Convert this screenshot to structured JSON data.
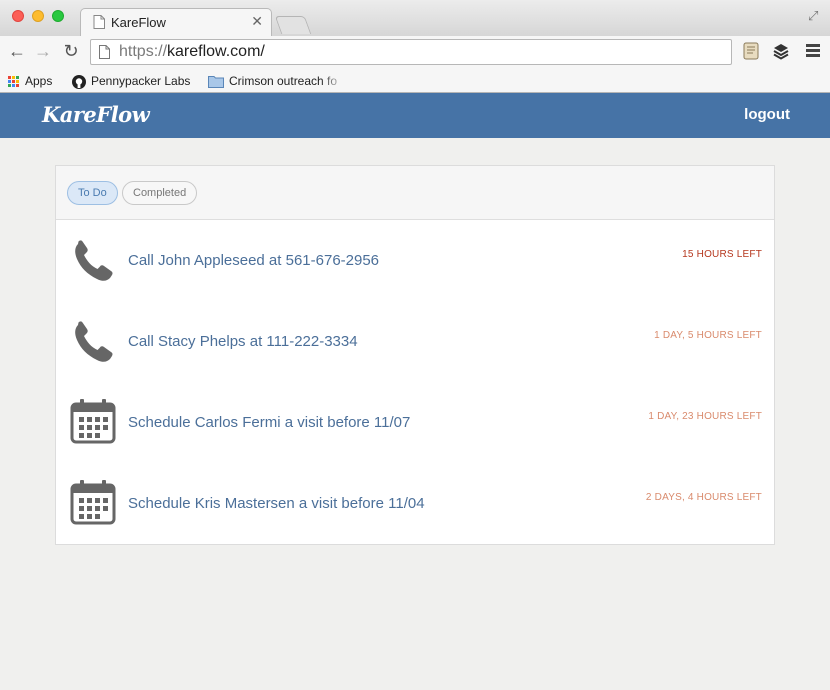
{
  "browser": {
    "tab_title": "KareFlow",
    "url_scheme": "https://",
    "url_rest": "kareflow.com/",
    "bookmarks": [
      {
        "label": "Apps",
        "icon": "apps-grid-icon"
      },
      {
        "label": "Pennypacker Labs",
        "icon": "github-icon"
      },
      {
        "label": "Crimson outreach fo",
        "icon": "folder-icon"
      }
    ]
  },
  "app": {
    "logo": "KareFlow",
    "logout_label": "logout",
    "brand_color": "#4673a6"
  },
  "filters": [
    {
      "label": "To Do",
      "active": true
    },
    {
      "label": "Completed",
      "active": false
    }
  ],
  "tasks": [
    {
      "icon": "phone-icon",
      "text": "Call John Appleseed at 561-676-2956",
      "due": "15 HOURS LEFT",
      "due_color": "#b5371e"
    },
    {
      "icon": "phone-icon",
      "text": "Call Stacy Phelps at 111-222-3334",
      "due": "1 DAY, 5 HOURS LEFT",
      "due_color": "#d98a6c"
    },
    {
      "icon": "calendar-icon",
      "text": "Schedule Carlos Fermi a visit before 11/07",
      "due": "1 DAY, 23 HOURS LEFT",
      "due_color": "#d98a6c"
    },
    {
      "icon": "calendar-icon",
      "text": "Schedule Kris Mastersen a visit before 11/04",
      "due": "2 DAYS, 4 HOURS LEFT",
      "due_color": "#d98a6c"
    }
  ]
}
